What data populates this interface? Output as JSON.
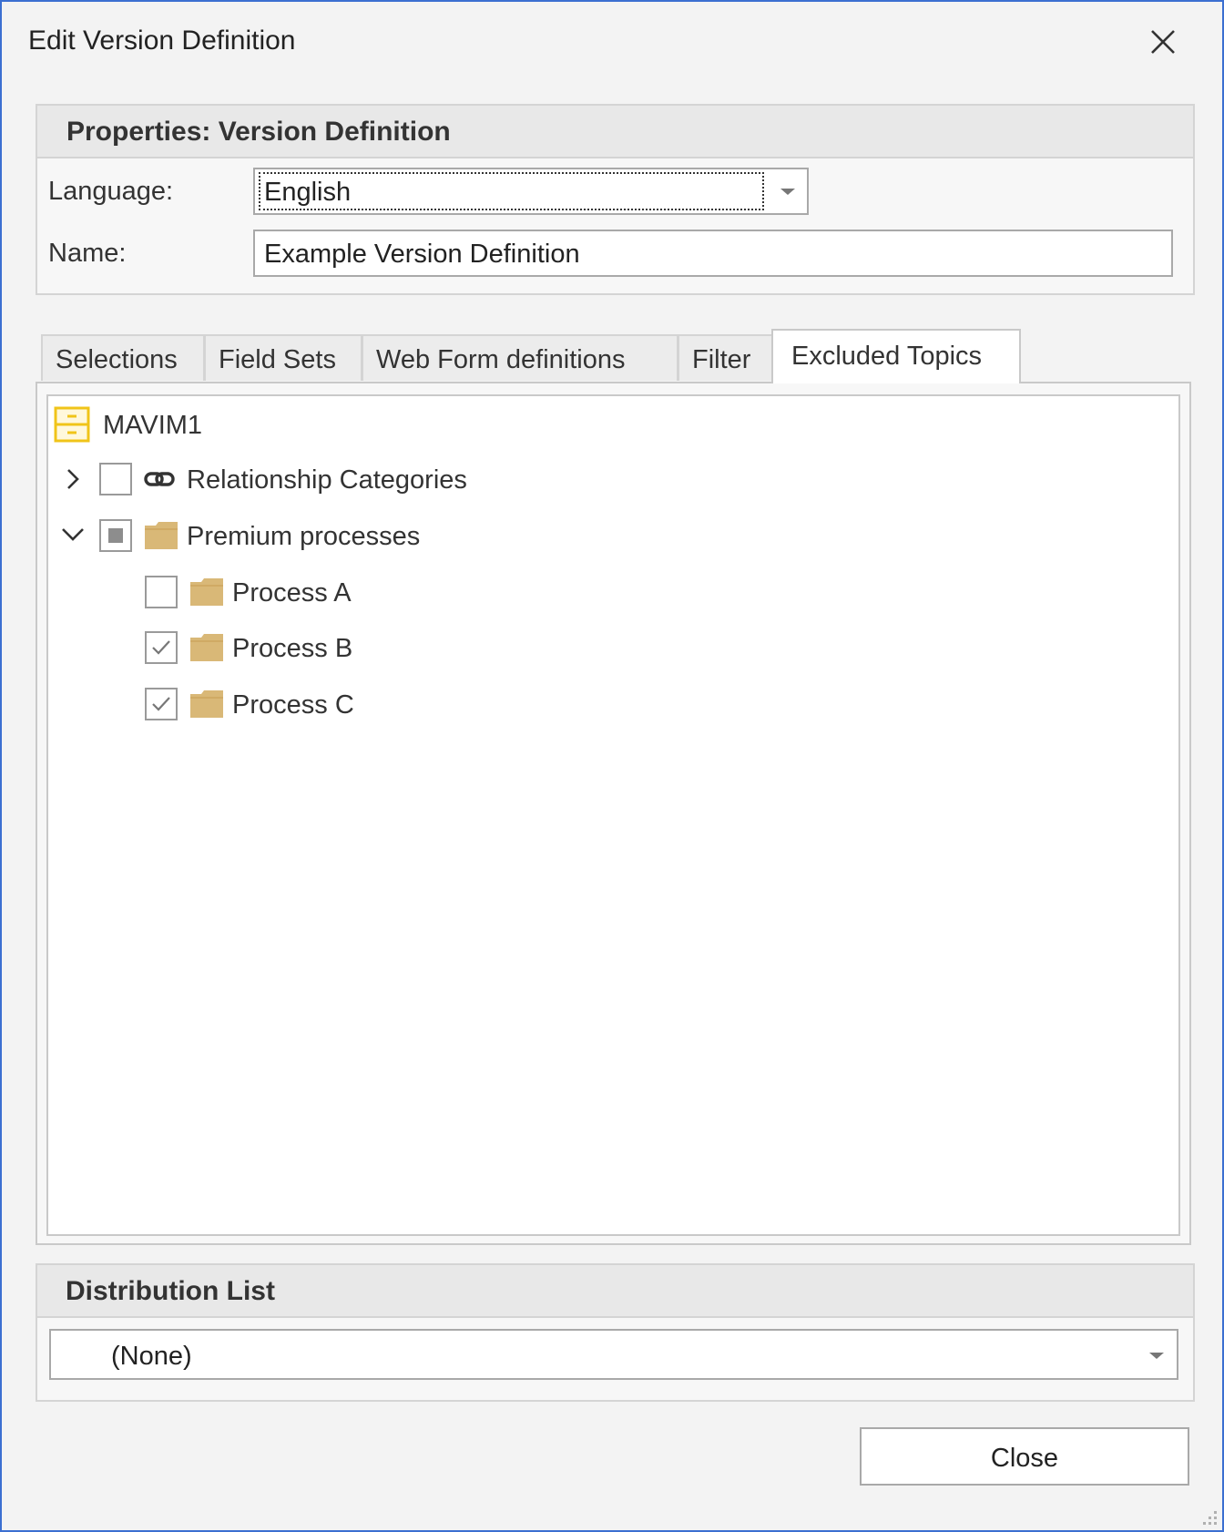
{
  "window": {
    "title": "Edit Version Definition"
  },
  "properties": {
    "header": "Properties: Version Definition",
    "language_label": "Language:",
    "language_value": "English",
    "name_label": "Name:",
    "name_value": "Example Version Definition"
  },
  "tabs": [
    {
      "label": "Selections",
      "active": false
    },
    {
      "label": "Field Sets",
      "active": false
    },
    {
      "label": "Web Form definitions",
      "active": false
    },
    {
      "label": "Filter",
      "active": false
    },
    {
      "label": "Excluded Topics",
      "active": true
    }
  ],
  "tree": {
    "root": {
      "label": "MAVIM1",
      "icon": "database-icon"
    },
    "items": [
      {
        "label": "Relationship Categories",
        "expanded": false,
        "checked": "unchecked",
        "icon": "link-icon"
      },
      {
        "label": "Premium processes",
        "expanded": true,
        "checked": "indeterminate",
        "icon": "folder-icon",
        "children": [
          {
            "label": "Process A",
            "checked": "unchecked",
            "icon": "folder-icon"
          },
          {
            "label": "Process B",
            "checked": "checked",
            "icon": "folder-icon"
          },
          {
            "label": "Process C",
            "checked": "checked",
            "icon": "folder-icon"
          }
        ]
      }
    ]
  },
  "distribution": {
    "header": "Distribution List",
    "selected": "(None)"
  },
  "buttons": {
    "close_label": "Close"
  },
  "colors": {
    "window_border": "#3b6fd1",
    "folder": "#d9b877",
    "database": "#f0c419"
  }
}
